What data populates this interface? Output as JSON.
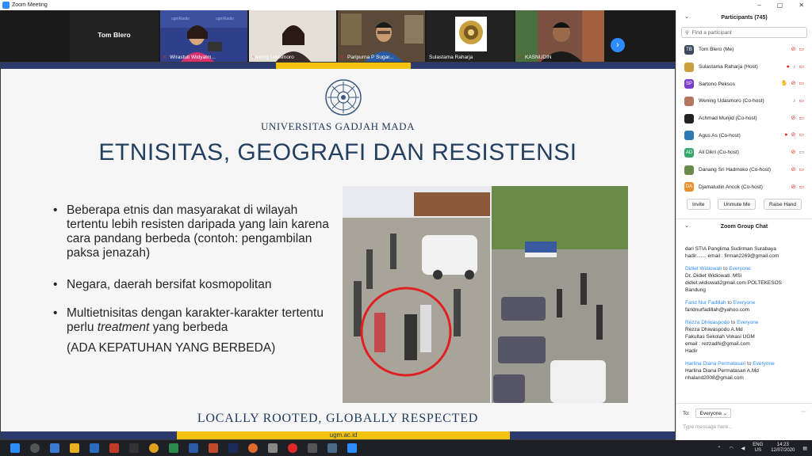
{
  "window": {
    "title": "Zoom Meeting",
    "controls": [
      "–",
      "▢",
      "✕"
    ]
  },
  "video_strip": {
    "tiles": [
      {
        "name": "Tom Blero",
        "type": "name_only"
      },
      {
        "name": "Wirastuti Widyatm...",
        "type": "video"
      },
      {
        "name": "Wening Udasmoro",
        "type": "video"
      },
      {
        "name": "Paripurna P Sugar...",
        "type": "video"
      },
      {
        "name": "Sulastama Raharja",
        "type": "logo"
      },
      {
        "name": "KASNUDIN",
        "type": "video"
      }
    ]
  },
  "slide": {
    "university": "UNIVERSITAS GADJAH MADA",
    "title": "ETNISITAS, GEOGRAFI DAN RESISTENSI",
    "bullets": [
      {
        "text": "Beberapa etnis dan masyarakat di wilayah tertentu lebih resisten daripada yang lain karena cara pandang berbeda (contoh: pengambilan paksa jenazah)"
      },
      {
        "text": "Negara, daerah bersifat kosmopolitan"
      },
      {
        "text_before": "Multietnisitas dengan karakter-karakter tertentu perlu ",
        "emphasis": "treatment",
        "text_after": " yang berbeda"
      }
    ],
    "note": "(ADA KEPATUHAN YANG BERBEDA)",
    "footer": "LOCALLY ROOTED, GLOBALLY RESPECTED",
    "website": "ugm.ac.id"
  },
  "participants": {
    "header": "Participants (745)",
    "search_placeholder": "Find a participant",
    "list": [
      {
        "initials": "TB",
        "name": "Tom Blero (Me)",
        "avatar_color": "#3a4a5c"
      },
      {
        "initials": "",
        "name": "Sulastama Raharja (Host)",
        "avatar_color": "#c8a040"
      },
      {
        "initials": "SP",
        "name": "Sartono Peksos",
        "avatar_color": "#7a3ec8"
      },
      {
        "initials": "",
        "name": "Wening Udasmoro (Co-host)",
        "avatar_color": "#b07860"
      },
      {
        "initials": "",
        "name": "Achmad Munjid (Co-host)",
        "avatar_color": "#222222"
      },
      {
        "initials": "",
        "name": "Agus As (Co-host)",
        "avatar_color": "#2a7ab0"
      },
      {
        "initials": "AD",
        "name": "Ali Dikri (Co-host)",
        "avatar_color": "#3aa86a"
      },
      {
        "initials": "",
        "name": "Danang Sri Hadmoko (Co-host)",
        "avatar_color": "#6a8a4a"
      },
      {
        "initials": "DA",
        "name": "Djamaludin Ancok (Co-host)",
        "avatar_color": "#e8902a"
      }
    ],
    "buttons": {
      "invite": "Invite",
      "unmute": "Unmute Me",
      "raise": "Raise Hand"
    }
  },
  "chat": {
    "header": "Zoom Group Chat",
    "messages": [
      {
        "from": "",
        "to": "",
        "lines": [
          "dari STIA Panglima Sudirman Surabaya",
          "hadir....... email : firman2269@gmail.com"
        ]
      },
      {
        "from": "Didiet Widiowati",
        "to": "Everyone",
        "lines": [
          "Dr. Didiet Widiowati. MSi",
          "didiet.widiowati2gmail.com POLTEKESOS",
          "Bandung"
        ]
      },
      {
        "from": "Farid Nur Fadillah",
        "to": "Everyone",
        "lines": [
          "faridnurfadillah@yahoo.com"
        ]
      },
      {
        "from": "Rezza Dhiwaspodo",
        "to": "Everyone",
        "lines": [
          "Rezza Dhiwaspodo A.Md",
          "Fakultas Sekolah Vokasi UGM",
          "email : rezzadhi@gmail.com",
          "Hadir"
        ]
      },
      {
        "from": "Harlina Diana Permatasari",
        "to": "Everyone",
        "lines": [
          "Harlina Diana Permatasari A.Md",
          "nhaland2008@gmail.com"
        ]
      }
    ],
    "to_label": "To:",
    "to_value": "Everyone",
    "input_placeholder": "Type message here..."
  },
  "taskbar": {
    "lang": "ENG",
    "region": "US",
    "time": "14:23",
    "date": "12/07/2020"
  },
  "colors": {
    "zoom_blue": "#2d8cff",
    "ugm_navy": "#2a3a6a",
    "ugm_gold": "#f3c20c",
    "muted_red": "#e02828"
  }
}
